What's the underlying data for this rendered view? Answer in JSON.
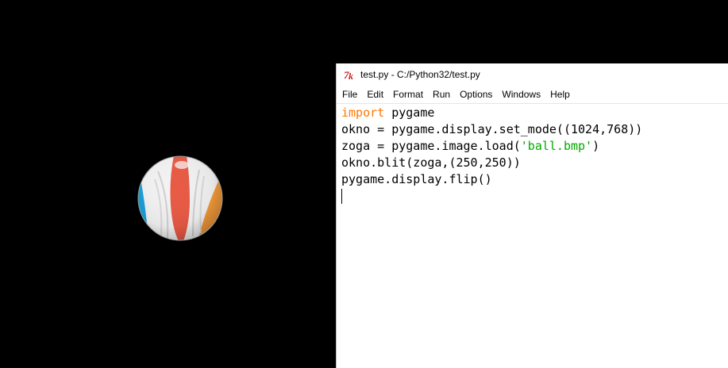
{
  "idle": {
    "title": "test.py - C:/Python32/test.py",
    "icon": "idle-python-icon",
    "menu": [
      {
        "label": "File"
      },
      {
        "label": "Edit"
      },
      {
        "label": "Format"
      },
      {
        "label": "Run"
      },
      {
        "label": "Options"
      },
      {
        "label": "Windows"
      },
      {
        "label": "Help"
      }
    ],
    "code": {
      "line1": {
        "keyword": "import",
        "rest": " pygame"
      },
      "line2": "okno = pygame.display.set_mode((1024,768))",
      "line3": {
        "before": "zoga = pygame.image.load(",
        "string": "'ball.bmp'",
        "after": ")"
      },
      "line4": "okno.blit(zoga,(250,250))",
      "line5": "pygame.display.flip()"
    },
    "syntax_colors": {
      "keyword": "#ff7700",
      "string": "#00aa00",
      "default": "#000000"
    }
  },
  "pygame_window": {
    "background": "#000000",
    "image": "beach-ball-image"
  }
}
